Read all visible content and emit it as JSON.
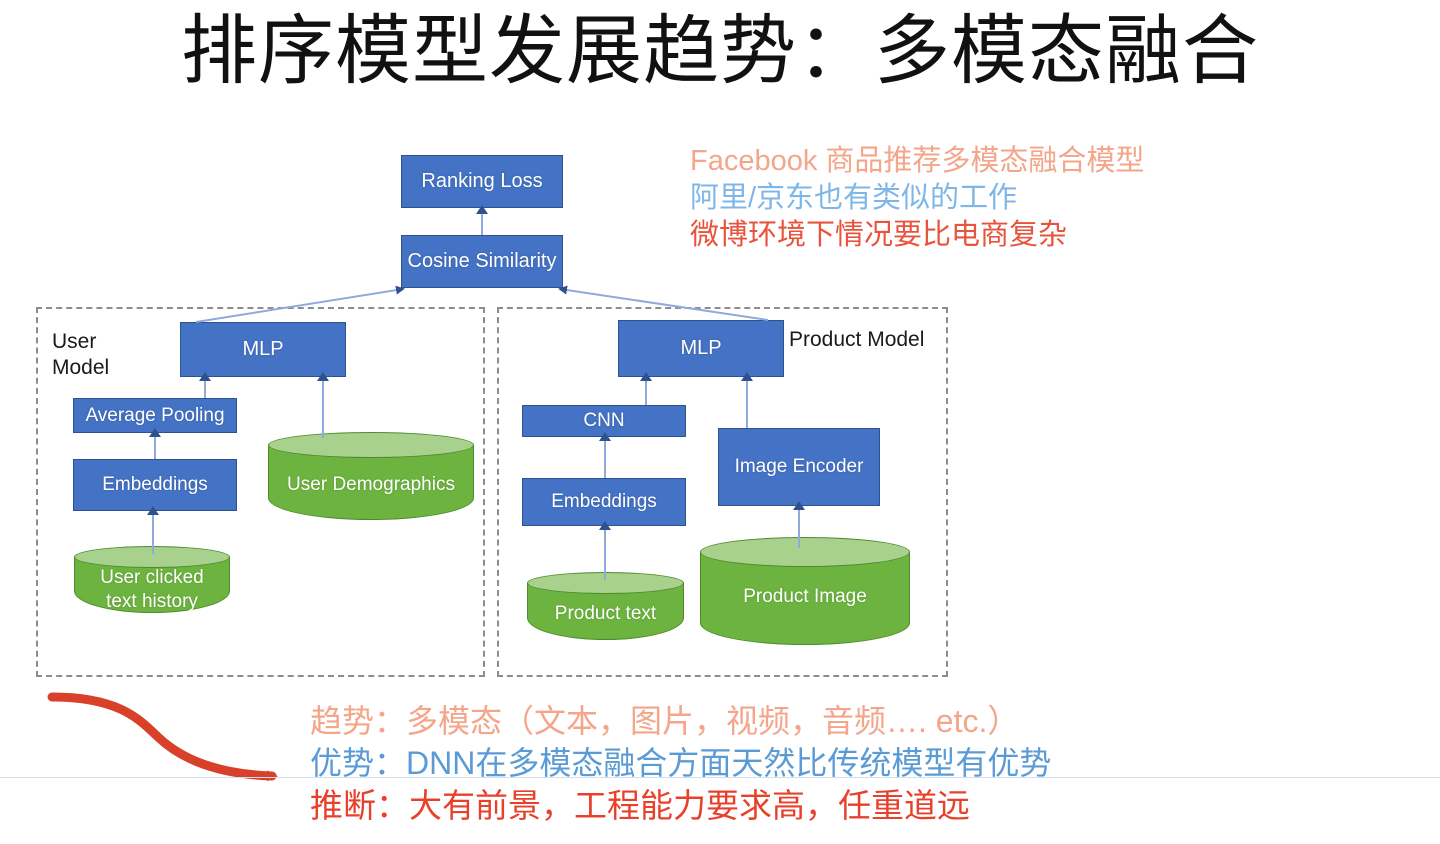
{
  "title": "排序模型发展趋势：多模态融合",
  "colors": {
    "node_blue": "#4472C4",
    "node_border": "#2F528F",
    "cylinder_green": "#6CB33F",
    "cylinder_top_green": "#A9D18E",
    "connector_blue": "#8FAADC",
    "salmon": "#F4A58A",
    "light_blue": "#5B9BD5",
    "red": "#E8402A",
    "dashed_gray": "#8a8d93",
    "rule_blue": "#cfe0f0"
  },
  "annotations_top": [
    {
      "text": "Facebook 商品推荐多模态融合模型",
      "color": "#F4A58A"
    },
    {
      "text": "阿里/京东也有类似的工作",
      "color": "#7EB6E8"
    },
    {
      "text": "微博环境下情况要比电商复杂",
      "color": "#E8533C"
    }
  ],
  "annotations_bottom": [
    {
      "text": "趋势：多模态（文本，图片，视频，音频…. etc.）",
      "color": "#F4A58A"
    },
    {
      "text": "优势：DNN在多模态融合方面天然比传统模型有优势",
      "color": "#5B9BD5"
    },
    {
      "text": "推断：大有前景，工程能力要求高，任重道远",
      "color": "#E8402A"
    }
  ],
  "diagram": {
    "top_nodes": [
      {
        "label": "Ranking Loss"
      },
      {
        "label": "Cosine Similarity"
      }
    ],
    "user_model": {
      "group_label": "User\nModel",
      "nodes": [
        {
          "label": "MLP"
        },
        {
          "label": "Average Pooling"
        },
        {
          "label": "Embeddings"
        }
      ],
      "cylinders": [
        {
          "label": "User Demographics"
        },
        {
          "label": "User clicked\ntext history"
        }
      ]
    },
    "product_model": {
      "group_label": "Product Model",
      "nodes": [
        {
          "label": "MLP"
        },
        {
          "label": "CNN"
        },
        {
          "label": "Embeddings"
        },
        {
          "label": "Image Encoder"
        }
      ],
      "cylinders": [
        {
          "label": "Product text"
        },
        {
          "label": "Product Image"
        }
      ]
    }
  }
}
